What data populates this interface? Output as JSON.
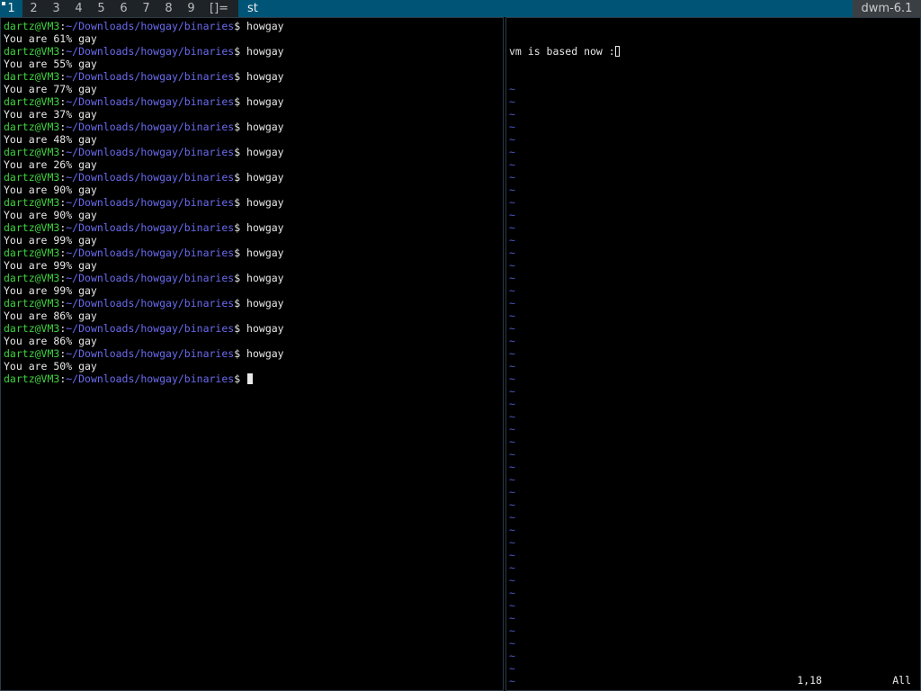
{
  "bar": {
    "tags": [
      "1",
      "2",
      "3",
      "4",
      "5",
      "6",
      "7",
      "8",
      "9"
    ],
    "selected_tag": "1",
    "layout_symbol": "[]=",
    "window_title": "st",
    "status_text": "dwm-6.1"
  },
  "terminal": {
    "user": "dartz@VM3",
    "sep": ":",
    "path": "~/Downloads/howgay/binaries",
    "prompt_suffix": "$ ",
    "command": "howgay",
    "outputs": [
      "You are 61% gay",
      "You are 55% gay",
      "You are 77% gay",
      "You are 37% gay",
      "You are 48% gay",
      "You are 26% gay",
      "You are 90% gay",
      "You are 90% gay",
      "You are 99% gay",
      "You are 99% gay",
      "You are 99% gay",
      "You are 86% gay",
      "You are 86% gay",
      "You are 50% gay"
    ]
  },
  "vim": {
    "first_line": "vm is based now :",
    "cursor_char": "",
    "tilde": "~",
    "tilde_count": 51,
    "ruler_position": "1,18",
    "ruler_scroll": "All"
  },
  "colors": {
    "bar_bg": "#1e2327",
    "accent": "#005577",
    "user_green": "#3fd43f",
    "path_blue": "#6b6bf0",
    "tilde_blue": "#4a5ac8"
  }
}
